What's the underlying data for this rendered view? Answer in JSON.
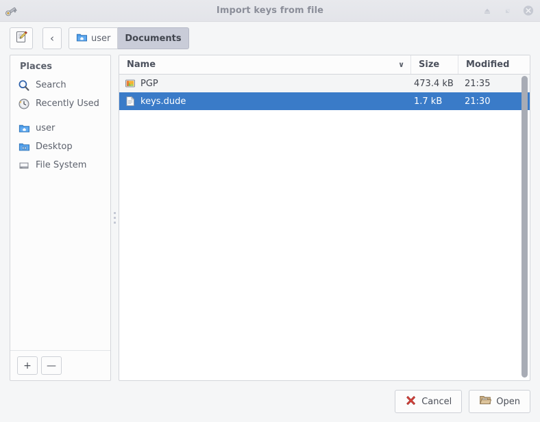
{
  "window": {
    "title": "Import keys from file",
    "app_icon": "key-icon",
    "controls": [
      {
        "name": "minimize-button",
        "icon": "minimize-icon"
      },
      {
        "name": "maximize-button",
        "icon": "maximize-icon"
      },
      {
        "name": "close-button",
        "icon": "close-icon"
      }
    ]
  },
  "toolbar": {
    "type_location_label": "",
    "type_location_icon": "edit-pencil-icon",
    "back_label": "‹",
    "breadcrumbs": [
      {
        "label": "user",
        "icon": "home-folder-icon",
        "active": false
      },
      {
        "label": "Documents",
        "icon": "",
        "active": true
      }
    ]
  },
  "sidebar": {
    "header": "Places",
    "items": [
      {
        "label": "Search",
        "icon": "search-icon"
      },
      {
        "label": "Recently Used",
        "icon": "recent-clock-icon"
      },
      {
        "label": "user",
        "icon": "home-folder-icon"
      },
      {
        "label": "Desktop",
        "icon": "desktop-folder-icon"
      },
      {
        "label": "File System",
        "icon": "harddrive-icon"
      }
    ],
    "add_label": "+",
    "remove_label": "—"
  },
  "filelist": {
    "columns": [
      {
        "key": "name",
        "label": "Name",
        "sorted": true,
        "sort_caret": "∨"
      },
      {
        "key": "size",
        "label": "Size"
      },
      {
        "key": "modified",
        "label": "Modified"
      }
    ],
    "rows": [
      {
        "name": "PGP",
        "size": "473.4 kB",
        "modified": "21:35",
        "icon": "image-file-icon",
        "selected": false
      },
      {
        "name": "keys.dude",
        "size": "1.7 kB",
        "modified": "21:30",
        "icon": "text-document-icon",
        "selected": true
      }
    ]
  },
  "footer": {
    "cancel_label": "Cancel",
    "cancel_icon": "red-x-icon",
    "open_label": "Open",
    "open_icon": "open-folder-icon"
  },
  "colors": {
    "selection": "#3a7bc8",
    "window_bg": "#f5f6f7",
    "titlebar_bg": "#e6e7ec",
    "text": "#5c616c",
    "accent_red": "#d94a44",
    "folder_tan": "#c9ad82"
  }
}
